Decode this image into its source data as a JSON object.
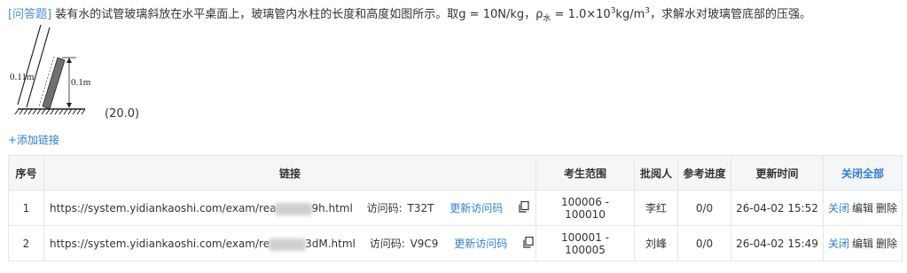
{
  "question": {
    "tag": "[问答题]",
    "text_a": "装有水的试管玻璃斜放在水平桌面上，玻璃管内水柱的长度和高度如图所示。取g = 10N/kg，ρ",
    "sub": "水",
    "text_b": " = 1.0×10",
    "sup1": "3",
    "text_c": "kg/m",
    "sup2": "3",
    "text_d": "，求解水对玻璃管底部的压强。",
    "score": "(20.0)",
    "figure": {
      "label_length": "0.11m",
      "label_height": "0.1m"
    }
  },
  "add_link_label": "+添加链接",
  "table": {
    "headers": {
      "index": "序号",
      "link": "链接",
      "range": "考生范围",
      "reviewer": "批阅人",
      "progress": "参考进度",
      "updated": "更新时间",
      "close_all": "关闭全部"
    },
    "rows": [
      {
        "index": "1",
        "url_prefix": "https://system.yidiankaoshi.com/exam/rea",
        "url_suffix": "9h.html",
        "code_label": "访问码:",
        "code": "T32T",
        "refresh_label": "更新访问码",
        "range": "100006 - 100010",
        "reviewer": "李红",
        "progress": "0/0",
        "updated": "26-04-02 15:52",
        "close_label": "关闭",
        "edit_label": "编辑",
        "delete_label": "删除"
      },
      {
        "index": "2",
        "url_prefix": "https://system.yidiankaoshi.com/exam/re",
        "url_suffix": "3dM.html",
        "code_label": "访问码:",
        "code": "V9C9",
        "refresh_label": "更新访问码",
        "range": "100001 - 100005",
        "reviewer": "刘峰",
        "progress": "0/0",
        "updated": "26-04-02 15:49",
        "close_label": "关闭",
        "edit_label": "编辑",
        "delete_label": "删除"
      }
    ]
  },
  "colors": {
    "link": "#2d7fd3",
    "tag": "#4a90d9",
    "header_bg": "#f5f6f8",
    "border": "#e3e6ea"
  },
  "icons": {
    "copy": "copy-icon"
  }
}
